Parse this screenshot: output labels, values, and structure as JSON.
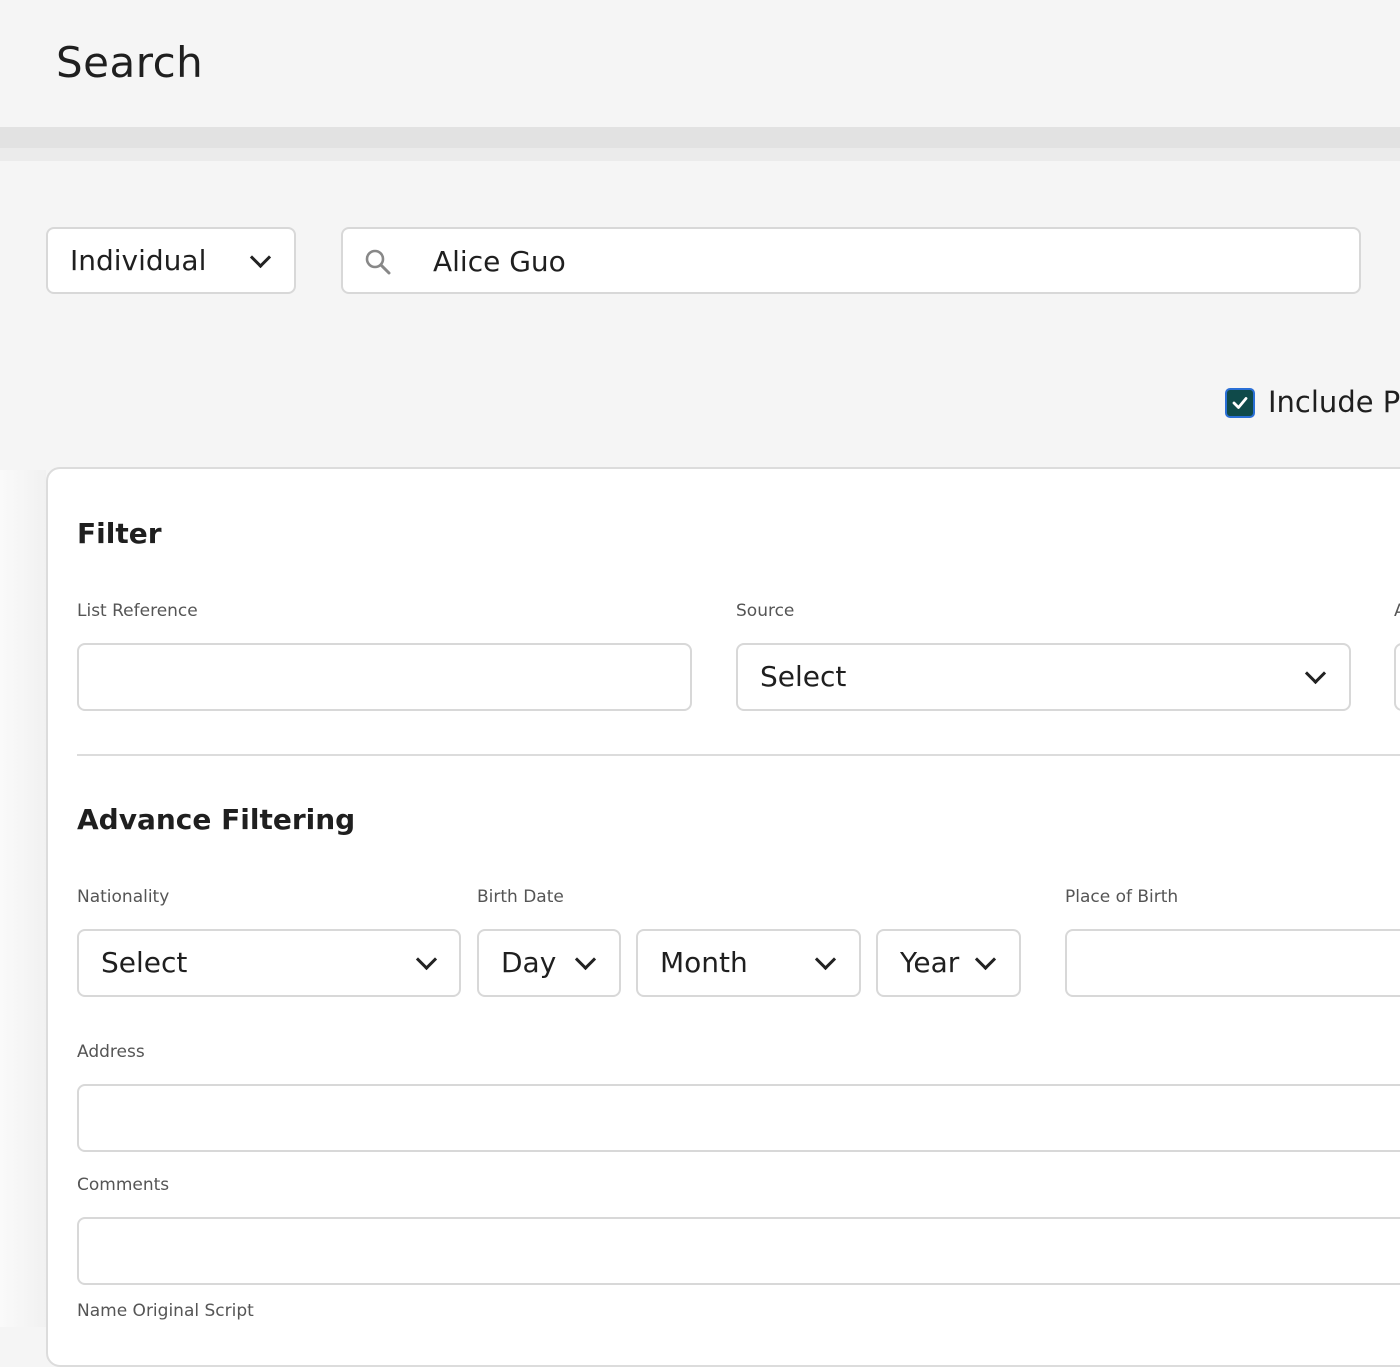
{
  "header": {
    "title": "Search"
  },
  "search": {
    "type_value": "Individual",
    "query_value": "Alice Guo"
  },
  "include": {
    "label": "Include PE",
    "checked": true
  },
  "filter": {
    "title": "Filter",
    "list_reference_label": "List Reference",
    "list_reference_value": "",
    "source_label": "Source",
    "source_value": "Select",
    "third_label_fragment": "A"
  },
  "advanced": {
    "title": "Advance Filtering",
    "nationality_label": "Nationality",
    "nationality_value": "Select",
    "birth_date_label": "Birth Date",
    "day_value": "Day",
    "month_value": "Month",
    "year_value": "Year",
    "place_of_birth_label": "Place of Birth",
    "place_of_birth_value": "",
    "address_label": "Address",
    "address_value": "",
    "comments_label": "Comments",
    "comments_value": "",
    "name_original_script_label": "Name Original Script"
  },
  "colors": {
    "checkbox_fill": "#0f4a4a",
    "checkbox_border": "#2a6fd6"
  }
}
